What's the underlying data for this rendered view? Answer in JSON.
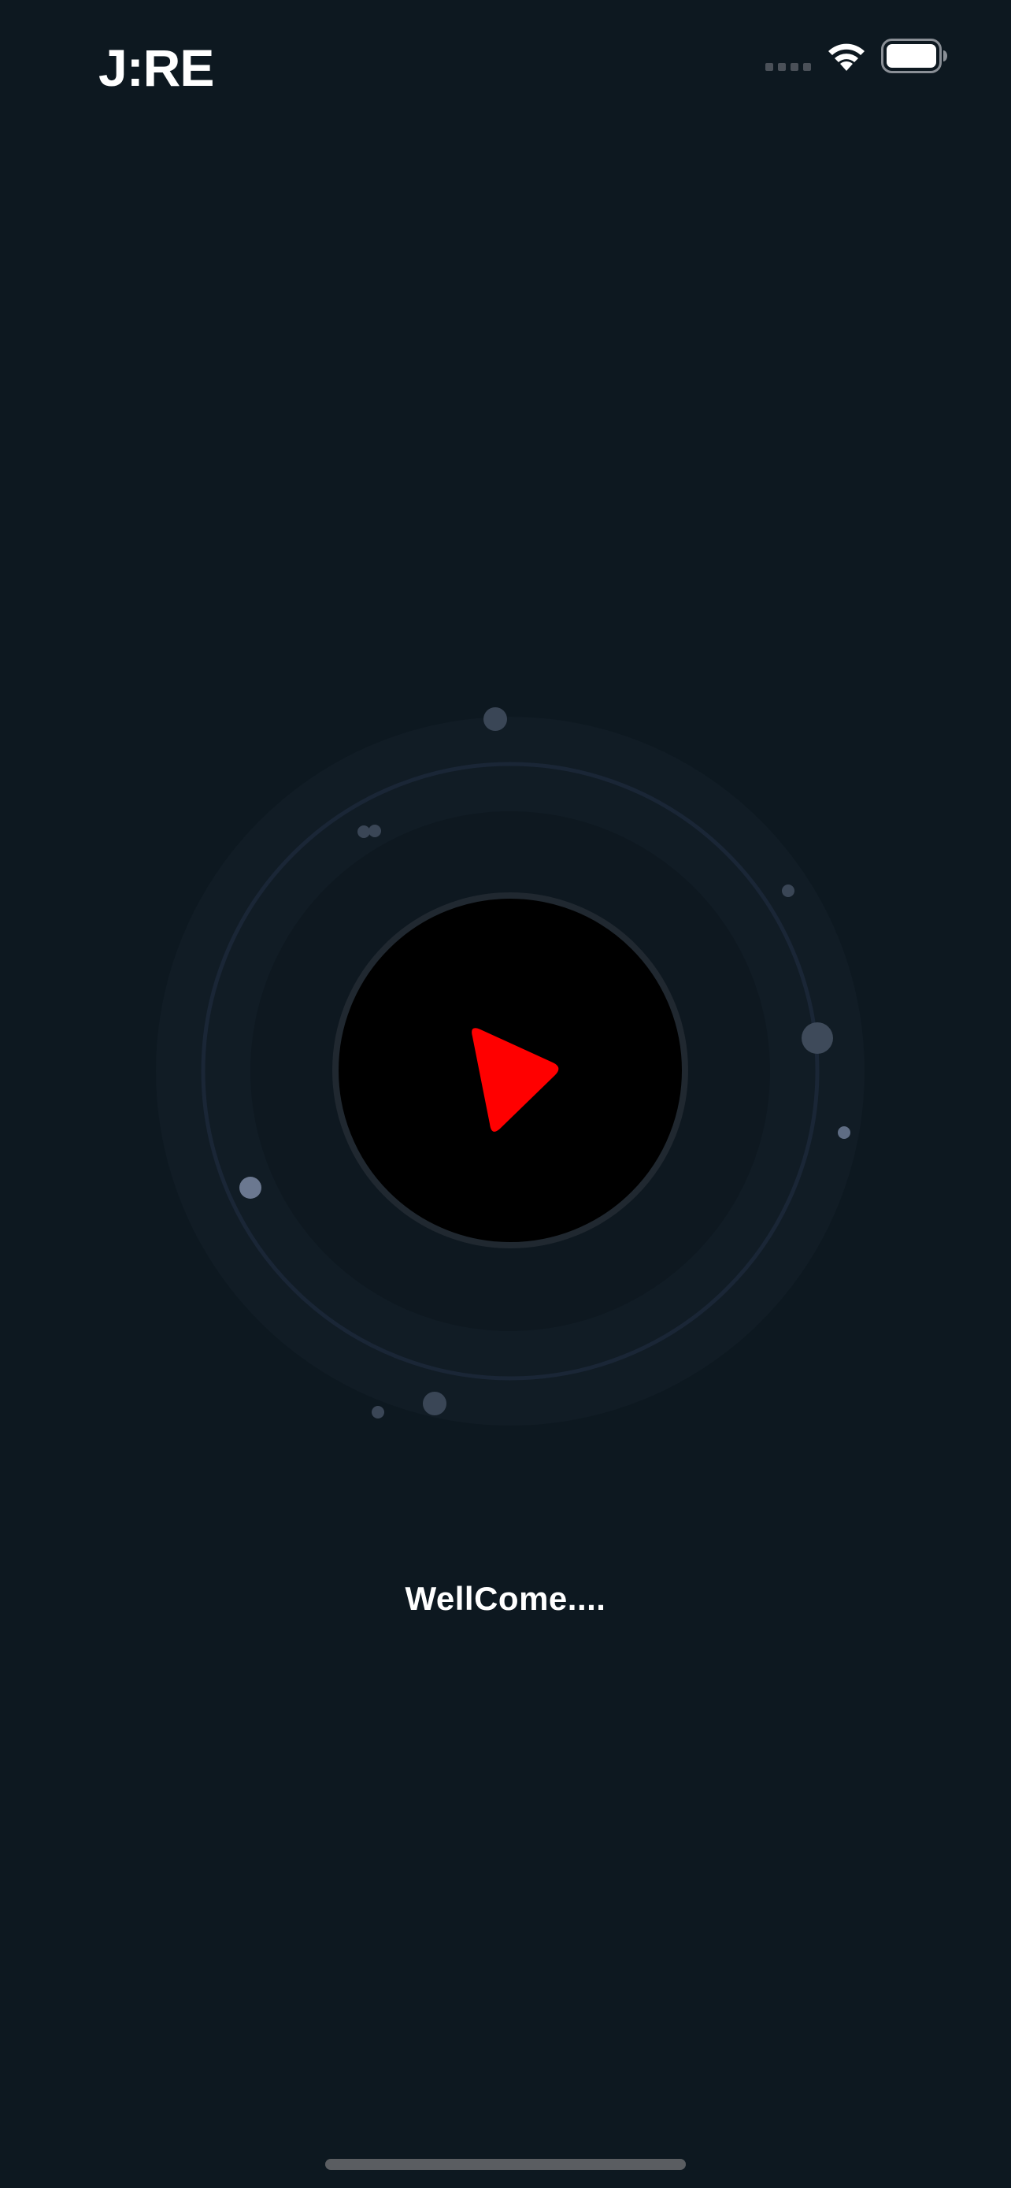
{
  "status_bar": {
    "time": "J:RE",
    "signal_icon": "cellular-signal-dots",
    "wifi_icon": "wifi",
    "battery_icon": "battery-full"
  },
  "main": {
    "play_icon": "play",
    "welcome_text": "WellCome...."
  },
  "colors": {
    "background": "#0d1820",
    "play_triangle": "#ff0000",
    "button_fill": "#000000",
    "orbit_dot": "#5f6d84"
  }
}
